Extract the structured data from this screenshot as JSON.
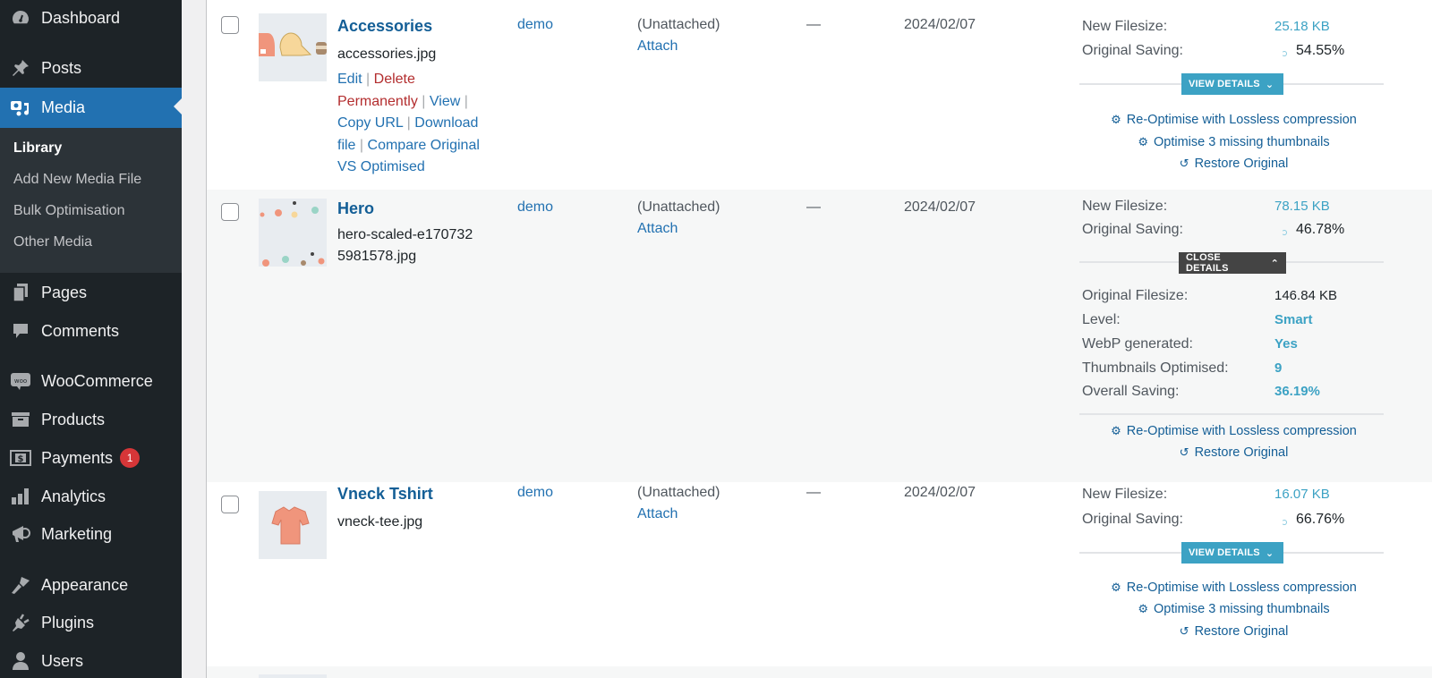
{
  "sidebar": {
    "items": [
      {
        "label": "Dashboard",
        "icon": "dashboard-icon"
      },
      {
        "label": "Posts",
        "icon": "pin-icon"
      },
      {
        "label": "Media",
        "icon": "media-icon",
        "active": true
      },
      {
        "label": "Pages",
        "icon": "pages-icon"
      },
      {
        "label": "Comments",
        "icon": "comment-icon"
      },
      {
        "label": "WooCommerce",
        "icon": "woo-icon"
      },
      {
        "label": "Products",
        "icon": "archive-icon"
      },
      {
        "label": "Payments",
        "icon": "payment-icon",
        "badge": "1"
      },
      {
        "label": "Analytics",
        "icon": "bar-chart-icon"
      },
      {
        "label": "Marketing",
        "icon": "megaphone-icon"
      },
      {
        "label": "Appearance",
        "icon": "brush-icon"
      },
      {
        "label": "Plugins",
        "icon": "plug-icon"
      },
      {
        "label": "Users",
        "icon": "user-icon"
      }
    ],
    "submenu": [
      {
        "label": "Library",
        "current": true
      },
      {
        "label": "Add New Media File"
      },
      {
        "label": "Bulk Optimisation"
      },
      {
        "label": "Other Media"
      }
    ]
  },
  "rows": [
    {
      "title": "Accessories",
      "filename": "accessories.jpg",
      "actions": {
        "edit": "Edit",
        "delete": "Delete Permanently",
        "view": "View",
        "copy_url": "Copy URL",
        "download": "Download file",
        "compare": "Compare Original VS Optimised"
      },
      "author": "demo",
      "uploaded_to": "(Unattached)",
      "attach": "Attach",
      "comments": "—",
      "date": "2024/02/07",
      "optimisation": {
        "new_filesize_label": "New Filesize:",
        "new_filesize": "25.18 KB",
        "saving_label": "Original Saving:",
        "saving": "54.55%",
        "toggle": "VIEW DETAILS",
        "reoptimise": "Re-Optimise with Lossless compression",
        "missing_thumbs": "Optimise 3 missing thumbnails",
        "restore": "Restore Original"
      }
    },
    {
      "title": "Hero",
      "filename": "hero-scaled-e1707325981578.jpg",
      "author": "demo",
      "uploaded_to": "(Unattached)",
      "attach": "Attach",
      "comments": "—",
      "date": "2024/02/07",
      "optimisation": {
        "new_filesize_label": "New Filesize:",
        "new_filesize": "78.15 KB",
        "saving_label": "Original Saving:",
        "saving": "46.78%",
        "toggle": "CLOSE DETAILS",
        "details": [
          {
            "label": "Original Filesize:",
            "value": "146.84 KB"
          },
          {
            "label": "Level:",
            "value": "Smart"
          },
          {
            "label": "WebP generated:",
            "value": "Yes"
          },
          {
            "label": "Thumbnails Optimised:",
            "value": "9"
          },
          {
            "label": "Overall Saving:",
            "value": "36.19%"
          }
        ],
        "reoptimise": "Re-Optimise with Lossless compression",
        "restore": "Restore Original"
      }
    },
    {
      "title": "Vneck Tshirt",
      "filename": "vneck-tee.jpg",
      "author": "demo",
      "uploaded_to": "(Unattached)",
      "attach": "Attach",
      "comments": "—",
      "date": "2024/02/07",
      "optimisation": {
        "new_filesize_label": "New Filesize:",
        "new_filesize": "16.07 KB",
        "saving_label": "Original Saving:",
        "saving": "66.76%",
        "toggle": "VIEW DETAILS",
        "reoptimise": "Re-Optimise with Lossless compression",
        "missing_thumbs": "Optimise 3 missing thumbnails",
        "restore": "Restore Original"
      }
    }
  ]
}
